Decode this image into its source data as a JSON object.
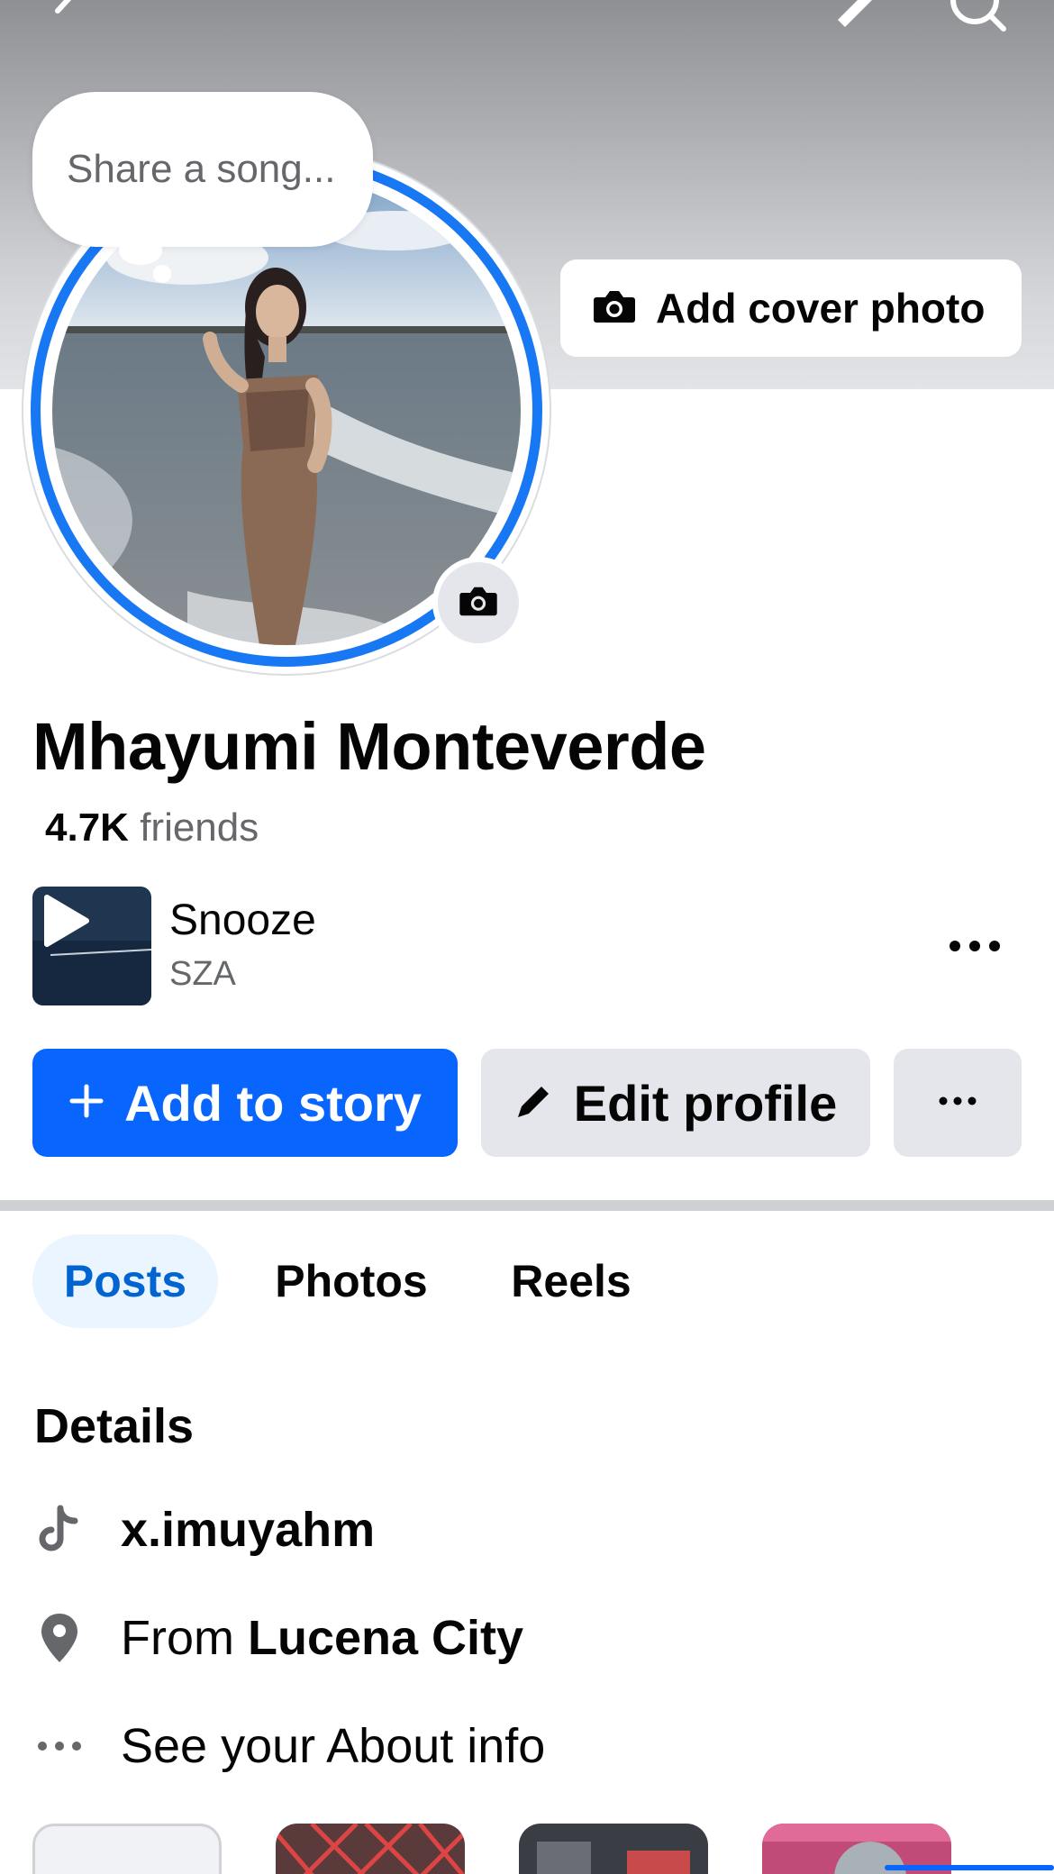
{
  "header": {
    "back_icon": "chevron-left-icon",
    "edit_icon": "pencil-icon",
    "search_icon": "search-icon"
  },
  "cover": {
    "add_cover_label": "Add cover photo",
    "add_cover_icon": "camera-icon"
  },
  "note_bubble": {
    "placeholder": "Share a song..."
  },
  "profile": {
    "name": "Mhayumi Monteverde",
    "friends_count": "4.7K",
    "friends_label": "friends",
    "story_ring_color": "#1877f2"
  },
  "song": {
    "title": "Snooze",
    "artist": "SZA",
    "play_icon": "play-icon",
    "more_icon": "more-horizontal-icon"
  },
  "actions": {
    "add_to_story": "Add to story",
    "edit_profile": "Edit profile",
    "more_label": "···",
    "accent": "#0866ff"
  },
  "tabs": [
    {
      "label": "Posts",
      "active": true
    },
    {
      "label": "Photos",
      "active": false
    },
    {
      "label": "Reels",
      "active": false
    }
  ],
  "details": {
    "title": "Details",
    "tiktok": "x.imuyahm",
    "from_prefix": "From",
    "from_city": "Lucena City",
    "about": "See your About info"
  }
}
